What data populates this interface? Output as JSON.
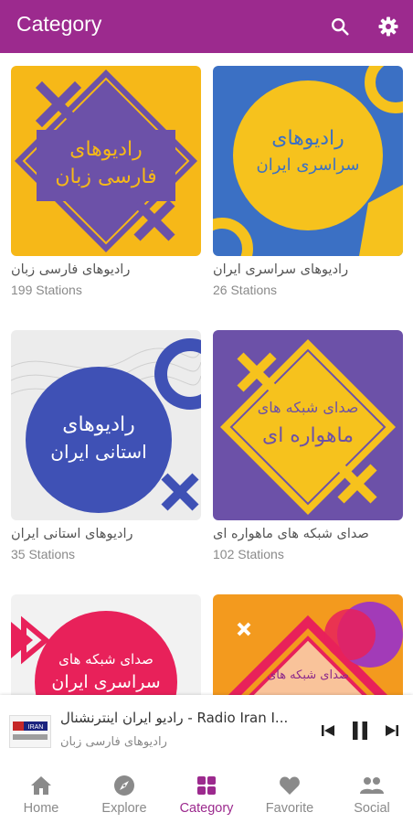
{
  "appbar": {
    "title": "Category",
    "bg_color": "#9c2a8e",
    "icons": [
      "search-icon",
      "gear-icon"
    ]
  },
  "categories": [
    {
      "thumb_text": [
        "رادیوهای",
        "فارسی زبان"
      ],
      "title": "رادیوهای فارسی زبان",
      "count": "199 Stations"
    },
    {
      "thumb_text": [
        "رادیوهای",
        "سراسری ایران"
      ],
      "title": "رادیوهای سراسری ایران",
      "count": "26 Stations"
    },
    {
      "thumb_text": [
        "رادیوهای",
        "استانی ایران"
      ],
      "title": "رادیوهای استانی ایران",
      "count": "35 Stations"
    },
    {
      "thumb_text": [
        "صدای شبکه های",
        "ماهواره ای"
      ],
      "title": "صدای شبکه های ماهواره ای",
      "count": "102 Stations"
    },
    {
      "thumb_text": [
        "صدای شبکه های",
        "سراسری ایران"
      ]
    },
    {
      "thumb_text": [
        "صدای شبکه های"
      ]
    }
  ],
  "player": {
    "logo_text": "IRAN",
    "title": "رادیو ایران اینترنشنال - Radio Iran I...",
    "subtitle": "رادیوهای فارسی زبان",
    "controls": [
      "skip-previous-icon",
      "pause-icon",
      "skip-next-icon"
    ]
  },
  "nav": {
    "items": [
      {
        "label": "Home",
        "icon": "home-icon"
      },
      {
        "label": "Explore",
        "icon": "compass-icon"
      },
      {
        "label": "Category",
        "icon": "category-grid-icon",
        "active": true
      },
      {
        "label": "Favorite",
        "icon": "heart-icon"
      },
      {
        "label": "Social",
        "icon": "people-icon"
      }
    ]
  }
}
